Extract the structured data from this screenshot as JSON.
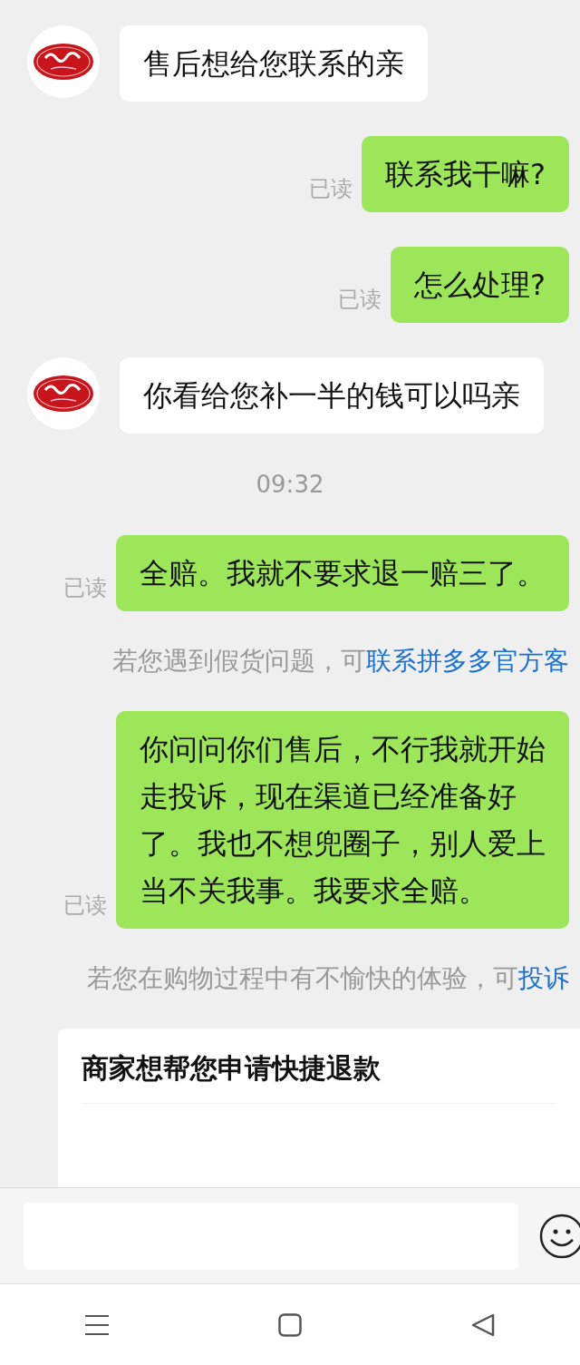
{
  "messages": [
    {
      "kind": "incoming",
      "text": "售后想给您联系的亲"
    },
    {
      "kind": "outgoing",
      "text": "联系我干嘛?",
      "status": "已读"
    },
    {
      "kind": "outgoing",
      "text": "怎么处理?",
      "status": "已读"
    },
    {
      "kind": "incoming",
      "text": "你看给您补一半的钱可以吗亲"
    },
    {
      "kind": "time",
      "text": "09:32"
    },
    {
      "kind": "outgoing",
      "text": "全赔。我就不要求退一赔三了。",
      "status": "已读"
    },
    {
      "kind": "notice",
      "text": "若您遇到假货问题，可",
      "link": "联系拼多多官方客"
    },
    {
      "kind": "outgoing",
      "text": "你问问你们售后，不行我就开始走投诉，现在渠道已经准备好了。我也不想兜圈子，别人爱上当不关我事。我要求全赔。",
      "status": "已读"
    },
    {
      "kind": "notice",
      "text": "若您在购物过程中有不愉快的体验，可",
      "link": "投诉"
    },
    {
      "kind": "card",
      "title": "商家想帮您申请快捷退款"
    }
  ]
}
